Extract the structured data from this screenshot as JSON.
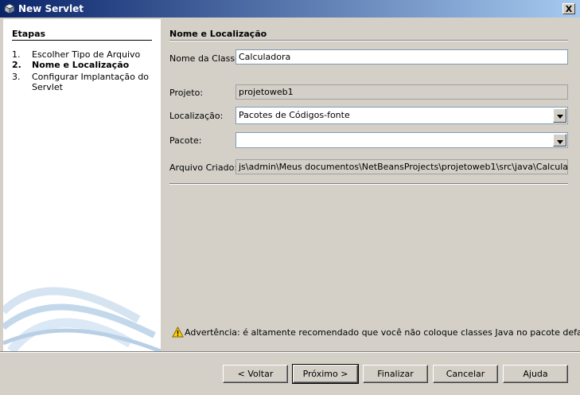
{
  "window": {
    "title": "New Servlet",
    "close_label": "X"
  },
  "steps": {
    "heading": "Etapas",
    "items": [
      {
        "num": "1.",
        "label": "Escolher Tipo de Arquivo"
      },
      {
        "num": "2.",
        "label": "Nome e Localização"
      },
      {
        "num": "3.",
        "label": "Configurar Implantação do Servlet"
      }
    ]
  },
  "form": {
    "section_title": "Nome e Localização",
    "class_name_label": "Nome da Classe:",
    "class_name_value": "Calculadora",
    "project_label": "Projeto:",
    "project_value": "projetoweb1",
    "location_label": "Localização:",
    "location_value": "Pacotes de Códigos-fonte",
    "package_label": "Pacote:",
    "package_value": "",
    "created_file_label": "Arquivo Criado:",
    "created_file_value": "js\\admin\\Meus documentos\\NetBeansProjects\\projetoweb1\\src\\java\\Calculadora.java"
  },
  "warning": {
    "icon": "warning-triangle-icon",
    "text": "Advertência: é altamente recomendado que você não coloque classes Java no pacote default."
  },
  "buttons": {
    "back": "< Voltar",
    "next": "Próximo >",
    "finish": "Finalizar",
    "cancel": "Cancelar",
    "help": "Ajuda"
  }
}
